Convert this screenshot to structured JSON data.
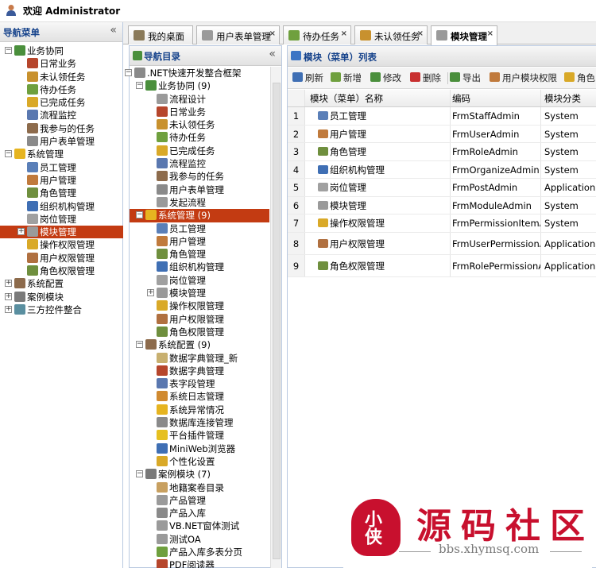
{
  "header": {
    "welcome": "欢迎 Administrator"
  },
  "nav_panel": {
    "title": "导航菜单",
    "collapse": "«",
    "items": [
      {
        "label": "业务协同",
        "level": 0,
        "expand": "⊟",
        "color": "#4a8f3c"
      },
      {
        "label": "日常业务",
        "level": 1,
        "color": "#b6462c"
      },
      {
        "label": "未认领任务",
        "level": 1,
        "color": "#c8912e"
      },
      {
        "label": "待办任务",
        "level": 1,
        "color": "#6fa03e"
      },
      {
        "label": "已完成任务",
        "level": 1,
        "color": "#d9a928"
      },
      {
        "label": "流程监控",
        "level": 1,
        "color": "#5a78b0"
      },
      {
        "label": "我参与的任务",
        "level": 1,
        "color": "#8d6b4c"
      },
      {
        "label": "用户表单管理",
        "level": 1,
        "color": "#8a8a8a"
      },
      {
        "label": "系统管理",
        "level": 0,
        "expand": "⊟",
        "color": "#e6b420"
      },
      {
        "label": "员工管理",
        "level": 1,
        "color": "#5a7fb8"
      },
      {
        "label": "用户管理",
        "level": 1,
        "color": "#c07a3c"
      },
      {
        "label": "角色管理",
        "level": 1,
        "color": "#6f8f3e"
      },
      {
        "label": "组织机构管理",
        "level": 1,
        "color": "#3f6fb4"
      },
      {
        "label": "岗位管理",
        "level": 1,
        "color": "#a0a0a0"
      },
      {
        "label": "模块管理",
        "level": 1,
        "expand": "⊞",
        "color": "#9a9a9a",
        "selected": true
      },
      {
        "label": "操作权限管理",
        "level": 1,
        "color": "#d9a928"
      },
      {
        "label": "用户权限管理",
        "level": 1,
        "color": "#b07040"
      },
      {
        "label": "角色权限管理",
        "level": 1,
        "color": "#6f8f3e"
      },
      {
        "label": "系统配置",
        "level": 0,
        "expand": "⊞",
        "color": "#8d6b4c"
      },
      {
        "label": "案例模块",
        "level": 0,
        "expand": "⊞",
        "color": "#7a7a7a"
      },
      {
        "label": "三方控件整合",
        "level": 0,
        "expand": "⊞",
        "color": "#5a8fa0"
      }
    ]
  },
  "tabs": [
    {
      "label": "我的桌面",
      "closable": false,
      "color": "#8a7a5a"
    },
    {
      "label": "用户表单管理",
      "closable": true,
      "color": "#9a9a9a"
    },
    {
      "label": "待办任务",
      "closable": true,
      "color": "#6fa03e"
    },
    {
      "label": "未认领任务",
      "closable": true,
      "color": "#c8912e"
    },
    {
      "label": "模块管理",
      "closable": true,
      "active": true,
      "color": "#9a9a9a"
    }
  ],
  "dir_panel": {
    "title": "导航目录",
    "collapse": "«",
    "items": [
      {
        "label": ".NET快速开发整合框架",
        "level": 0,
        "expand": "⊟",
        "color": "#8a8a8a"
      },
      {
        "label": "业务协同 (9)",
        "level": 1,
        "expand": "⊟",
        "color": "#4a8f3c"
      },
      {
        "label": "流程设计",
        "level": 2,
        "color": "#9a9a9a"
      },
      {
        "label": "日常业务",
        "level": 2,
        "color": "#b6462c"
      },
      {
        "label": "未认领任务",
        "level": 2,
        "color": "#c8912e"
      },
      {
        "label": "待办任务",
        "level": 2,
        "color": "#6fa03e"
      },
      {
        "label": "已完成任务",
        "level": 2,
        "color": "#d9a928"
      },
      {
        "label": "流程监控",
        "level": 2,
        "color": "#5a78b0"
      },
      {
        "label": "我参与的任务",
        "level": 2,
        "color": "#8d6b4c"
      },
      {
        "label": "用户表单管理",
        "level": 2,
        "color": "#8a8a8a"
      },
      {
        "label": "发起流程",
        "level": 2,
        "color": "#9a9a9a"
      },
      {
        "label": "系统管理 (9)",
        "level": 1,
        "expand": "⊟",
        "color": "#e6b420",
        "selected": true
      },
      {
        "label": "员工管理",
        "level": 2,
        "color": "#5a7fb8"
      },
      {
        "label": "用户管理",
        "level": 2,
        "color": "#c07a3c"
      },
      {
        "label": "角色管理",
        "level": 2,
        "color": "#6f8f3e"
      },
      {
        "label": "组织机构管理",
        "level": 2,
        "color": "#3f6fb4"
      },
      {
        "label": "岗位管理",
        "level": 2,
        "color": "#a0a0a0"
      },
      {
        "label": "模块管理",
        "level": 2,
        "expand": "⊞",
        "color": "#9a9a9a"
      },
      {
        "label": "操作权限管理",
        "level": 2,
        "color": "#d9a928"
      },
      {
        "label": "用户权限管理",
        "level": 2,
        "color": "#b07040"
      },
      {
        "label": "角色权限管理",
        "level": 2,
        "color": "#6f8f3e"
      },
      {
        "label": "系统配置 (9)",
        "level": 1,
        "expand": "⊟",
        "color": "#8d6b4c"
      },
      {
        "label": "数据字典管理_新",
        "level": 2,
        "color": "#c8b070"
      },
      {
        "label": "数据字典管理",
        "level": 2,
        "color": "#b6462c"
      },
      {
        "label": "表字段管理",
        "level": 2,
        "color": "#5a78b0"
      },
      {
        "label": "系统日志管理",
        "level": 2,
        "color": "#d08a30"
      },
      {
        "label": "系统异常情况",
        "level": 2,
        "color": "#e6b420"
      },
      {
        "label": "数据库连接管理",
        "level": 2,
        "color": "#8a8a8a"
      },
      {
        "label": "平台插件管理",
        "level": 2,
        "color": "#e6c020"
      },
      {
        "label": "MiniWeb浏览器",
        "level": 2,
        "color": "#3f6fb4"
      },
      {
        "label": "个性化设置",
        "level": 2,
        "color": "#d9a928"
      },
      {
        "label": "案例模块 (7)",
        "level": 1,
        "expand": "⊟",
        "color": "#7a7a7a"
      },
      {
        "label": "地籍案卷目录",
        "level": 2,
        "color": "#c8a060"
      },
      {
        "label": "产品管理",
        "level": 2,
        "color": "#9a9a9a"
      },
      {
        "label": "产品入库",
        "level": 2,
        "color": "#8a8a8a"
      },
      {
        "label": "VB.NET窗体测试",
        "level": 2,
        "color": "#9a9a9a"
      },
      {
        "label": "测试OA",
        "level": 2,
        "color": "#9a9a9a"
      },
      {
        "label": "产品入库多表分页",
        "level": 2,
        "color": "#6fa03e"
      },
      {
        "label": "PDF阅读器",
        "level": 2,
        "color": "#b6462c"
      }
    ]
  },
  "list_panel": {
    "title": "模块（菜单）列表",
    "toolbar": [
      {
        "label": "刷新",
        "color": "#3f6fb4"
      },
      {
        "label": "新增",
        "color": "#6fa03e"
      },
      {
        "label": "修改",
        "color": "#4a8f3c"
      },
      {
        "label": "删除",
        "color": "#c83030"
      },
      {
        "label": "导出",
        "color": "#4a8f3c"
      },
      {
        "label": "用户模块权限",
        "color": "#c07a3c"
      },
      {
        "label": "角色",
        "color": "#d9a928"
      }
    ],
    "columns": [
      "模块（菜单）名称",
      "编码",
      "模块分类"
    ],
    "rows": [
      {
        "no": "1",
        "name": "员工管理",
        "code": "FrmStaffAdmin",
        "cat": "System",
        "color": "#5a7fb8"
      },
      {
        "no": "2",
        "name": "用户管理",
        "code": "FrmUserAdmin",
        "cat": "System",
        "color": "#c07a3c"
      },
      {
        "no": "3",
        "name": "角色管理",
        "code": "FrmRoleAdmin",
        "cat": "System",
        "color": "#6f8f3e"
      },
      {
        "no": "4",
        "name": "组织机构管理",
        "code": "FrmOrganizeAdmin",
        "cat": "System",
        "color": "#3f6fb4"
      },
      {
        "no": "5",
        "name": "岗位管理",
        "code": "FrmPostAdmin",
        "cat": "Application",
        "color": "#a0a0a0"
      },
      {
        "no": "6",
        "name": "模块管理",
        "code": "FrmModuleAdmin",
        "cat": "System",
        "color": "#9a9a9a"
      },
      {
        "no": "7",
        "name": "操作权限管理",
        "code": "FrmPermissionItemA",
        "cat": "System",
        "color": "#d9a928"
      },
      {
        "no": "8",
        "name": "用户权限管理",
        "code": "FrmUserPermissionA",
        "cat": "Application",
        "color": "#b07040"
      },
      {
        "no": "9",
        "name": "角色权限管理",
        "code": "FrmRolePermissionA",
        "cat": "Application",
        "color": "#6f8f3e"
      }
    ]
  },
  "watermark": {
    "logo_text": "小侠",
    "title": "源码社区",
    "url": "bbs.xhymsq.com"
  }
}
